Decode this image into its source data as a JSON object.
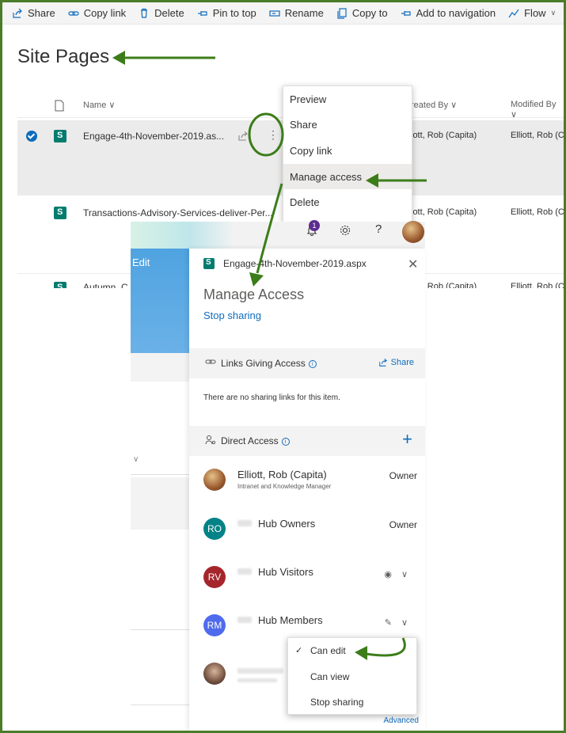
{
  "toolbar": {
    "share": "Share",
    "copy_link": "Copy link",
    "delete": "Delete",
    "pin_to_top": "Pin to top",
    "rename": "Rename",
    "copy_to": "Copy to",
    "add_to_navigation": "Add to navigation",
    "flow": "Flow"
  },
  "page": {
    "title": "Site Pages"
  },
  "list": {
    "columns": {
      "name": "Name",
      "created_by": "reated By",
      "modified_by": "Modified By"
    },
    "rows": [
      {
        "name": "Engage-4th-November-2019.as...",
        "created_by": "iott, Rob (Capita)",
        "modified_by": "Elliott, Rob (Ca"
      },
      {
        "name": "Transactions-Advisory-Services-deliver-Per...",
        "created_by": "iott, Rob (Capita)",
        "modified_by": "Elliott, Rob (Ca"
      },
      {
        "name": "Autumn_C",
        "created_by": "iott, Rob (Capita)",
        "modified_by": "Elliott, Rob (Ca"
      }
    ]
  },
  "context_menu": {
    "items": [
      "Preview",
      "Share",
      "Copy link",
      "Manage access",
      "Delete"
    ]
  },
  "header_bar": {
    "notifications_count": "1",
    "edit_label": "Edit"
  },
  "manage_access": {
    "file_name": "Engage-4th-November-2019.aspx",
    "heading": "Manage Access",
    "stop_sharing": "Stop sharing",
    "links_section": {
      "label": "Links Giving Access",
      "share_label": "Share",
      "empty_text": "There are no sharing links for this item."
    },
    "direct_section": {
      "label": "Direct Access"
    },
    "people": [
      {
        "name": "Elliott, Rob (Capita)",
        "subtitle": "Intranet and Knowledge Manager",
        "role": "Owner",
        "initials": "",
        "color": "#b07a3a"
      },
      {
        "name": "Hub Owners",
        "subtitle": "",
        "role": "Owner",
        "initials": "RO",
        "color": "#038387"
      },
      {
        "name": "Hub Visitors",
        "subtitle": "",
        "role": "",
        "initials": "RV",
        "color": "#a4262c"
      },
      {
        "name": "Hub Members",
        "subtitle": "",
        "role": "",
        "initials": "RM",
        "color": "#4f6bed"
      }
    ],
    "advanced": "Advanced"
  },
  "permission_menu": {
    "items": [
      "Can edit",
      "Can view",
      "Stop sharing"
    ],
    "selected": "Can edit"
  },
  "colors": {
    "accent": "#0f6cbd",
    "annotation_green": "#3c7d1a",
    "frame_green": "#4a7c2a"
  }
}
